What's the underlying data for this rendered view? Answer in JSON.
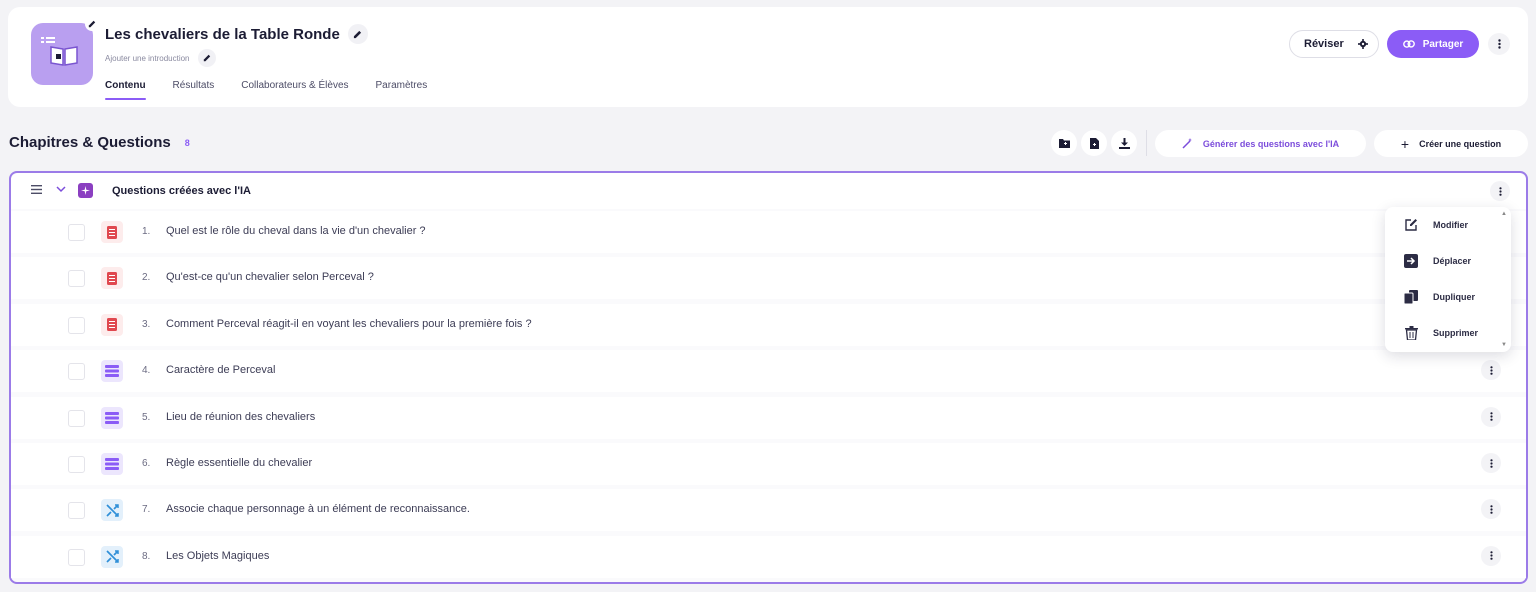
{
  "quiz": {
    "title": "Les chevaliers de la Table Ronde",
    "subtitle": "Ajouter une introduction"
  },
  "tabs": [
    {
      "label": "Contenu",
      "active": true
    },
    {
      "label": "Résultats",
      "active": false
    },
    {
      "label": "Collaborateurs & Élèves",
      "active": false
    },
    {
      "label": "Paramètres",
      "active": false
    }
  ],
  "actions": {
    "reviser_label": "Réviser",
    "partager_label": "Partager",
    "generate_label": "Générer des questions avec l'IA",
    "create_label": "Créer une question"
  },
  "section": {
    "title": "Chapitres & Questions",
    "count": "8"
  },
  "chapter": {
    "title": "Questions créées avec l'IA",
    "questions": [
      {
        "number": "1.",
        "text": "Quel est le rôle du cheval dans la vie d'un chevalier ?",
        "type": "open"
      },
      {
        "number": "2.",
        "text": "Qu'est-ce qu'un chevalier selon Perceval ?",
        "type": "open"
      },
      {
        "number": "3.",
        "text": "Comment Perceval réagit-il en voyant les chevaliers pour la première fois ?",
        "type": "open"
      },
      {
        "number": "4.",
        "text": "Caractère de Perceval",
        "type": "choice"
      },
      {
        "number": "5.",
        "text": "Lieu de réunion des chevaliers",
        "type": "choice"
      },
      {
        "number": "6.",
        "text": "Règle essentielle du chevalier",
        "type": "choice"
      },
      {
        "number": "7.",
        "text": "Associe chaque personnage à un élément de reconnaissance.",
        "type": "match"
      },
      {
        "number": "8.",
        "text": "Les Objets Magiques",
        "type": "match"
      }
    ]
  },
  "menu": {
    "items": [
      {
        "label": "Modifier",
        "icon": "edit-icon"
      },
      {
        "label": "Déplacer",
        "icon": "move-icon"
      },
      {
        "label": "Dupliquer",
        "icon": "duplicate-icon"
      },
      {
        "label": "Supprimer",
        "icon": "trash-icon"
      }
    ]
  },
  "colors": {
    "accent": "#8b5cf6",
    "open_icon": "#e0484f",
    "choice_icon": "#8b5cf6",
    "match_icon": "#2f8fd8"
  }
}
